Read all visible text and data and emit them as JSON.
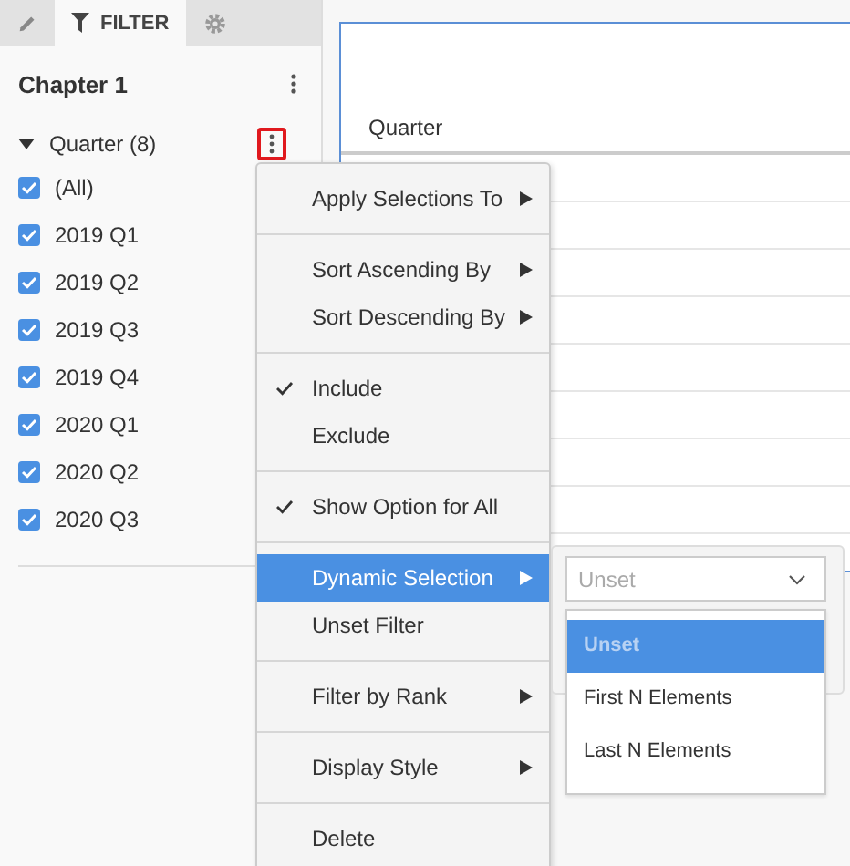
{
  "tabs": [
    {
      "kind": "pencil",
      "selected": false
    },
    {
      "kind": "filter",
      "label": "FILTER",
      "selected": true
    },
    {
      "kind": "gear",
      "selected": false
    }
  ],
  "chapter": {
    "title": "Chapter 1"
  },
  "filter": {
    "name": "Quarter (8)",
    "expanded": true,
    "items": [
      {
        "label": "(All)",
        "checked": true
      },
      {
        "label": "2019 Q1",
        "checked": true
      },
      {
        "label": "2019 Q2",
        "checked": true
      },
      {
        "label": "2019 Q3",
        "checked": true
      },
      {
        "label": "2019 Q4",
        "checked": true
      },
      {
        "label": "2020 Q1",
        "checked": true
      },
      {
        "label": "2020 Q2",
        "checked": true
      },
      {
        "label": "2020 Q3",
        "checked": true
      }
    ]
  },
  "table": {
    "columns": [
      "Quarter"
    ]
  },
  "context_menu": {
    "groups": [
      [
        {
          "label": "Apply Selections To",
          "submenu": true,
          "checked": false,
          "selected": false
        }
      ],
      [
        {
          "label": "Sort Ascending By",
          "submenu": true,
          "checked": false,
          "selected": false
        },
        {
          "label": "Sort Descending By",
          "submenu": true,
          "checked": false,
          "selected": false
        }
      ],
      [
        {
          "label": "Include",
          "submenu": false,
          "checked": true,
          "selected": false
        },
        {
          "label": "Exclude",
          "submenu": false,
          "checked": false,
          "selected": false
        }
      ],
      [
        {
          "label": "Show Option for All",
          "submenu": false,
          "checked": true,
          "selected": false
        }
      ],
      [
        {
          "label": "Dynamic Selection",
          "submenu": true,
          "checked": false,
          "selected": true
        },
        {
          "label": "Unset Filter",
          "submenu": false,
          "checked": false,
          "selected": false
        }
      ],
      [
        {
          "label": "Filter by Rank",
          "submenu": true,
          "checked": false,
          "selected": false
        }
      ],
      [
        {
          "label": "Display Style",
          "submenu": true,
          "checked": false,
          "selected": false
        }
      ],
      [
        {
          "label": "Delete",
          "submenu": false,
          "checked": false,
          "selected": false
        }
      ]
    ]
  },
  "dynamic_selection": {
    "value": "Unset",
    "options": [
      {
        "label": "Unset",
        "selected": true
      },
      {
        "label": "First N Elements",
        "selected": false
      },
      {
        "label": "Last N Elements",
        "selected": false
      }
    ]
  }
}
